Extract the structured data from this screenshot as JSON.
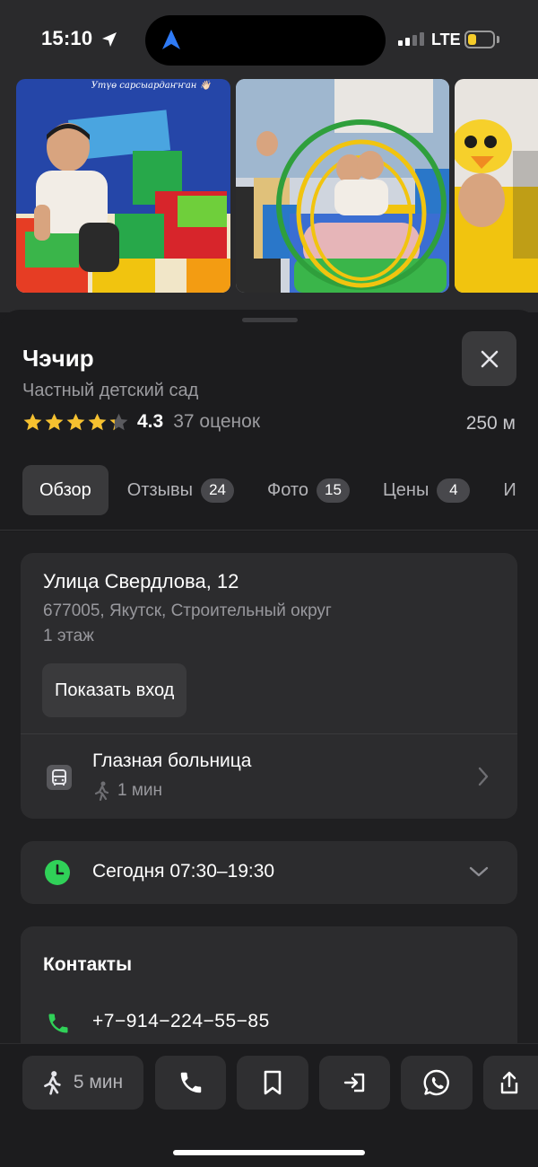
{
  "status_bar": {
    "time": "15:10",
    "network": "LTE",
    "battery_level": 0.35,
    "signal_bars": 2
  },
  "photos": {
    "caption_first": "Утүө сарсыардаҥҥан 👋🏻"
  },
  "place": {
    "name": "Чэчир",
    "category": "Частный детский сад",
    "rating": "4.3",
    "rating_stars": 4.3,
    "ratings_count": "37 оценок",
    "distance": "250 м"
  },
  "tabs": [
    {
      "label": "Обзор",
      "badge": null
    },
    {
      "label": "Отзывы",
      "badge": "24"
    },
    {
      "label": "Фото",
      "badge": "15"
    },
    {
      "label": "Цены",
      "badge": "4"
    },
    {
      "label": "И",
      "badge": null
    }
  ],
  "address": {
    "street": "Улица Свердлова, 12",
    "locality": "677005, Якутск, Строительный округ",
    "floor": "1 этаж",
    "entrance_button": "Показать вход"
  },
  "transit": {
    "stop_name": "Глазная больница",
    "walk_time": "1 мин"
  },
  "hours": {
    "today": "Сегодня 07:30–19:30"
  },
  "contacts": {
    "title": "Контакты",
    "phone": "+7−914−224−55−85"
  },
  "actions": {
    "walk_label": "5 мин"
  },
  "colors": {
    "star": "#f6c12f",
    "green": "#30d158",
    "battery": "#f5cc2a",
    "nav_blue": "#2f7bf6"
  },
  "icons": [
    "location-arrow-icon",
    "navigation-icon",
    "close-icon",
    "star-icon",
    "bus-icon",
    "walk-icon",
    "chevron-right-icon",
    "clock-icon",
    "chevron-down-icon",
    "phone-icon",
    "bookmark-icon",
    "route-icon",
    "whatsapp-icon",
    "share-icon"
  ]
}
